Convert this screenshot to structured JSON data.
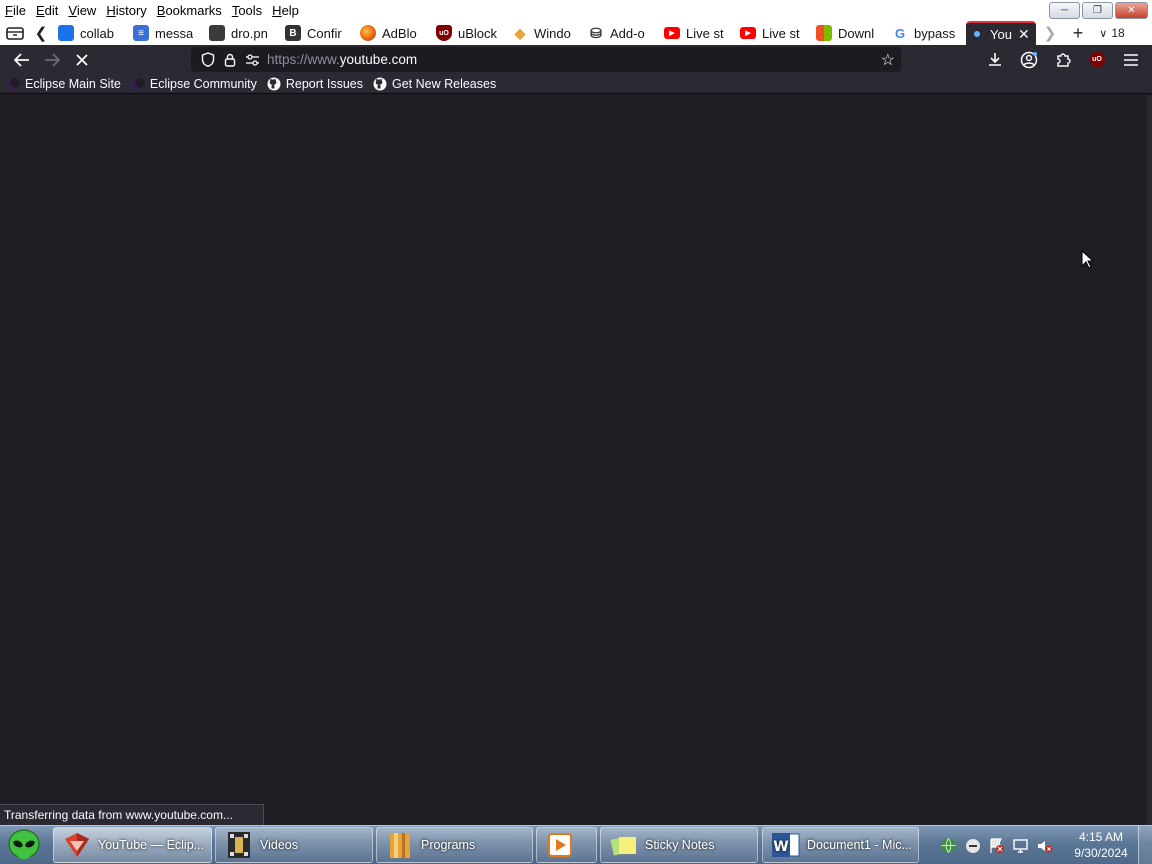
{
  "menubar": {
    "items": [
      "File",
      "Edit",
      "View",
      "History",
      "Bookmarks",
      "Tools",
      "Help"
    ]
  },
  "tabs": {
    "list": [
      {
        "title": "collab",
        "icon": "blue-square-icon",
        "color": "#1a73e8"
      },
      {
        "title": "messa",
        "icon": "doc-icon",
        "color": "#3b6fd8"
      },
      {
        "title": "dro.pn",
        "icon": "image-icon",
        "color": "#3a3a3a"
      },
      {
        "title": "Confir",
        "icon": "b-icon",
        "color": "#333333"
      },
      {
        "title": "AdBlo",
        "icon": "firefox-icon",
        "color": "#e66000"
      },
      {
        "title": "uBlock",
        "icon": "ublock-icon",
        "color": "#800000"
      },
      {
        "title": "Windo",
        "icon": "diamond-icon",
        "color": "#e8a33d"
      },
      {
        "title": "Add-o",
        "icon": "puzzle-icon",
        "color": "#333333"
      },
      {
        "title": "Live st",
        "icon": "youtube-icon",
        "color": "#ff0000"
      },
      {
        "title": "Live st",
        "icon": "youtube-icon",
        "color": "#ff0000"
      },
      {
        "title": "Downl",
        "icon": "windows-icon",
        "color": "#f25022"
      },
      {
        "title": "bypass",
        "icon": "google-icon",
        "color": "#4285f4"
      }
    ],
    "active": {
      "title": "You",
      "icon": "loading-dot-icon"
    },
    "count": "18"
  },
  "navbar": {
    "url_prefix": "https://www.",
    "url_domain": "youtube.com"
  },
  "bookmarks": [
    {
      "label": "Eclipse Main Site",
      "icon": "eclipse-icon"
    },
    {
      "label": "Eclipse Community",
      "icon": "eclipse-icon"
    },
    {
      "label": "Report Issues",
      "icon": "github-icon"
    },
    {
      "label": "Get New Releases",
      "icon": "github-icon"
    }
  ],
  "status": {
    "text": "Transferring data from www.youtube.com..."
  },
  "taskbar": {
    "tasks": [
      {
        "label": "YouTube — Eclip...",
        "icon": "browser-icon",
        "active": true
      },
      {
        "label": "Videos",
        "icon": "videos-folder-icon",
        "active": false
      },
      {
        "label": "Programs",
        "icon": "programs-folder-icon",
        "active": false
      },
      {
        "label": "",
        "icon": "media-player-icon",
        "active": false
      },
      {
        "label": "Sticky Notes",
        "icon": "sticky-notes-icon",
        "active": false
      },
      {
        "label": "Document1 - Mic...",
        "icon": "word-icon",
        "active": false
      }
    ],
    "clock": {
      "time": "4:15 AM",
      "date": "9/30/2024"
    }
  },
  "colors": {
    "chrome_bg": "#2b2a33",
    "content_bg": "#1f1e25",
    "active_tab_accent": "#e6353f",
    "taskbar": "#5c7696"
  }
}
